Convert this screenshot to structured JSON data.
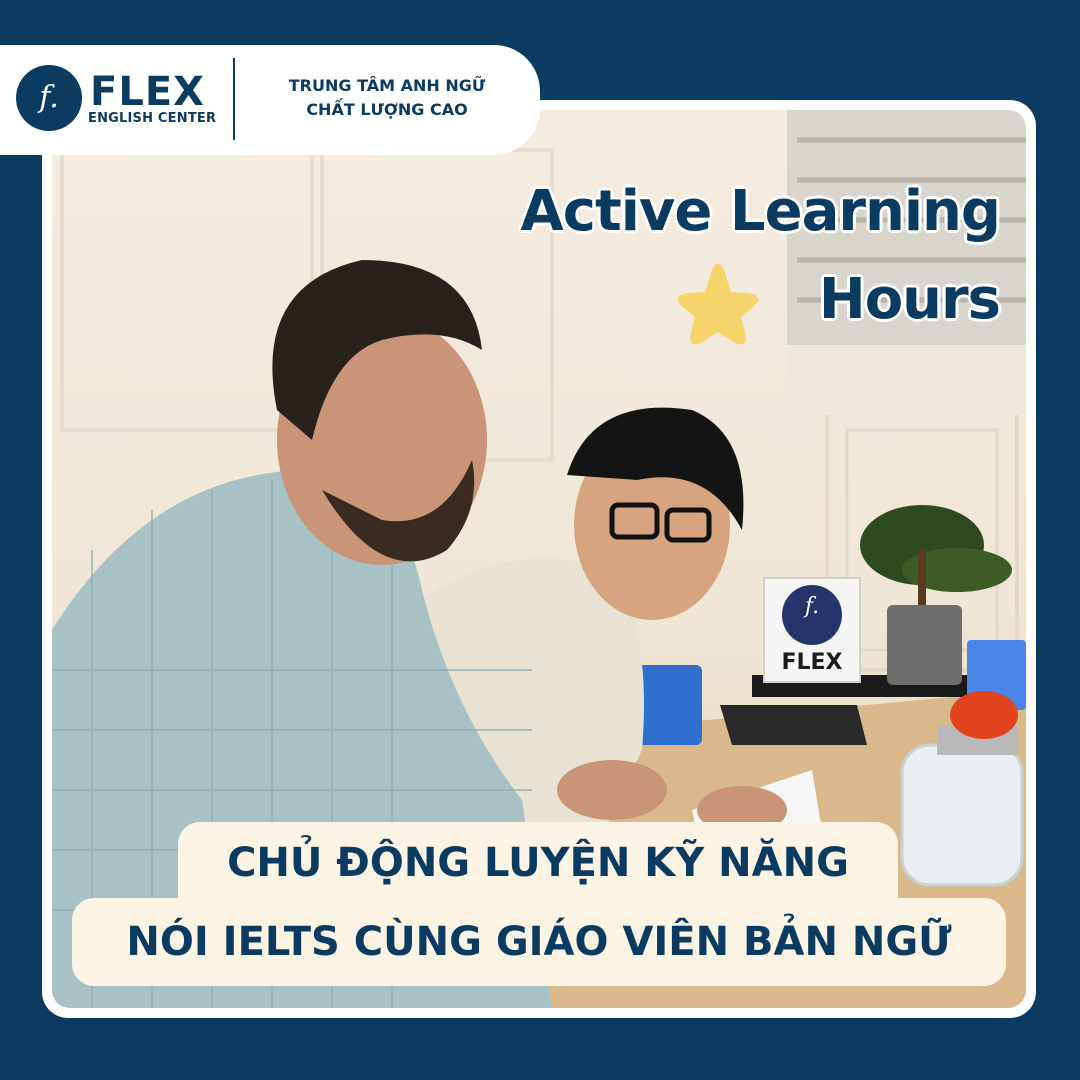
{
  "header": {
    "logo_letter": "f.",
    "brand_name": "FLEX",
    "brand_subtitle": "ENGLISH CENTER",
    "tagline_line1": "TRUNG TÂM ANH NGỮ",
    "tagline_line2": "CHẤT LƯỢNG CAO"
  },
  "headline": {
    "line1": "Active Learning",
    "line2": "Hours"
  },
  "caption": {
    "line1": "CHỦ ĐỘNG LUYỆN KỸ NĂNG",
    "line2": "NÓI IELTS CÙNG GIÁO VIÊN BẢN NGỮ"
  },
  "photo": {
    "desk_sign_letter": "f.",
    "desk_sign_text": "FLEX"
  },
  "colors": {
    "navy": "#0c3b62",
    "cream": "#fbf3e4",
    "star": "#f6d36b"
  },
  "icons": {
    "star": "star-icon",
    "logo": "flex-logo-icon"
  }
}
